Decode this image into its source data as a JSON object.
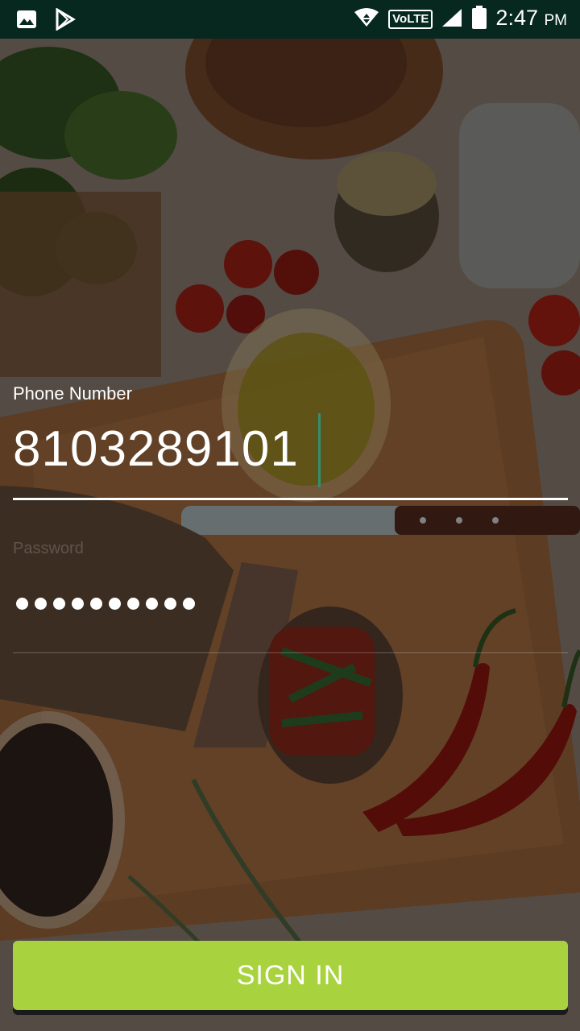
{
  "status_bar": {
    "time": "2:47",
    "ampm": "PM",
    "network_label": "VoLTE",
    "icons": [
      "image-icon",
      "play-store-icon",
      "hotspot-icon",
      "signal-icon",
      "battery-icon"
    ]
  },
  "form": {
    "phone_label": "Phone Number",
    "phone_value": "8103289101",
    "password_placeholder": "Password",
    "password_masked_length": 10
  },
  "actions": {
    "sign_in_label": "SIGN IN"
  },
  "colors": {
    "status_bar": "#06281f",
    "accent": "#a9d23f",
    "cursor": "#2f8f73"
  }
}
